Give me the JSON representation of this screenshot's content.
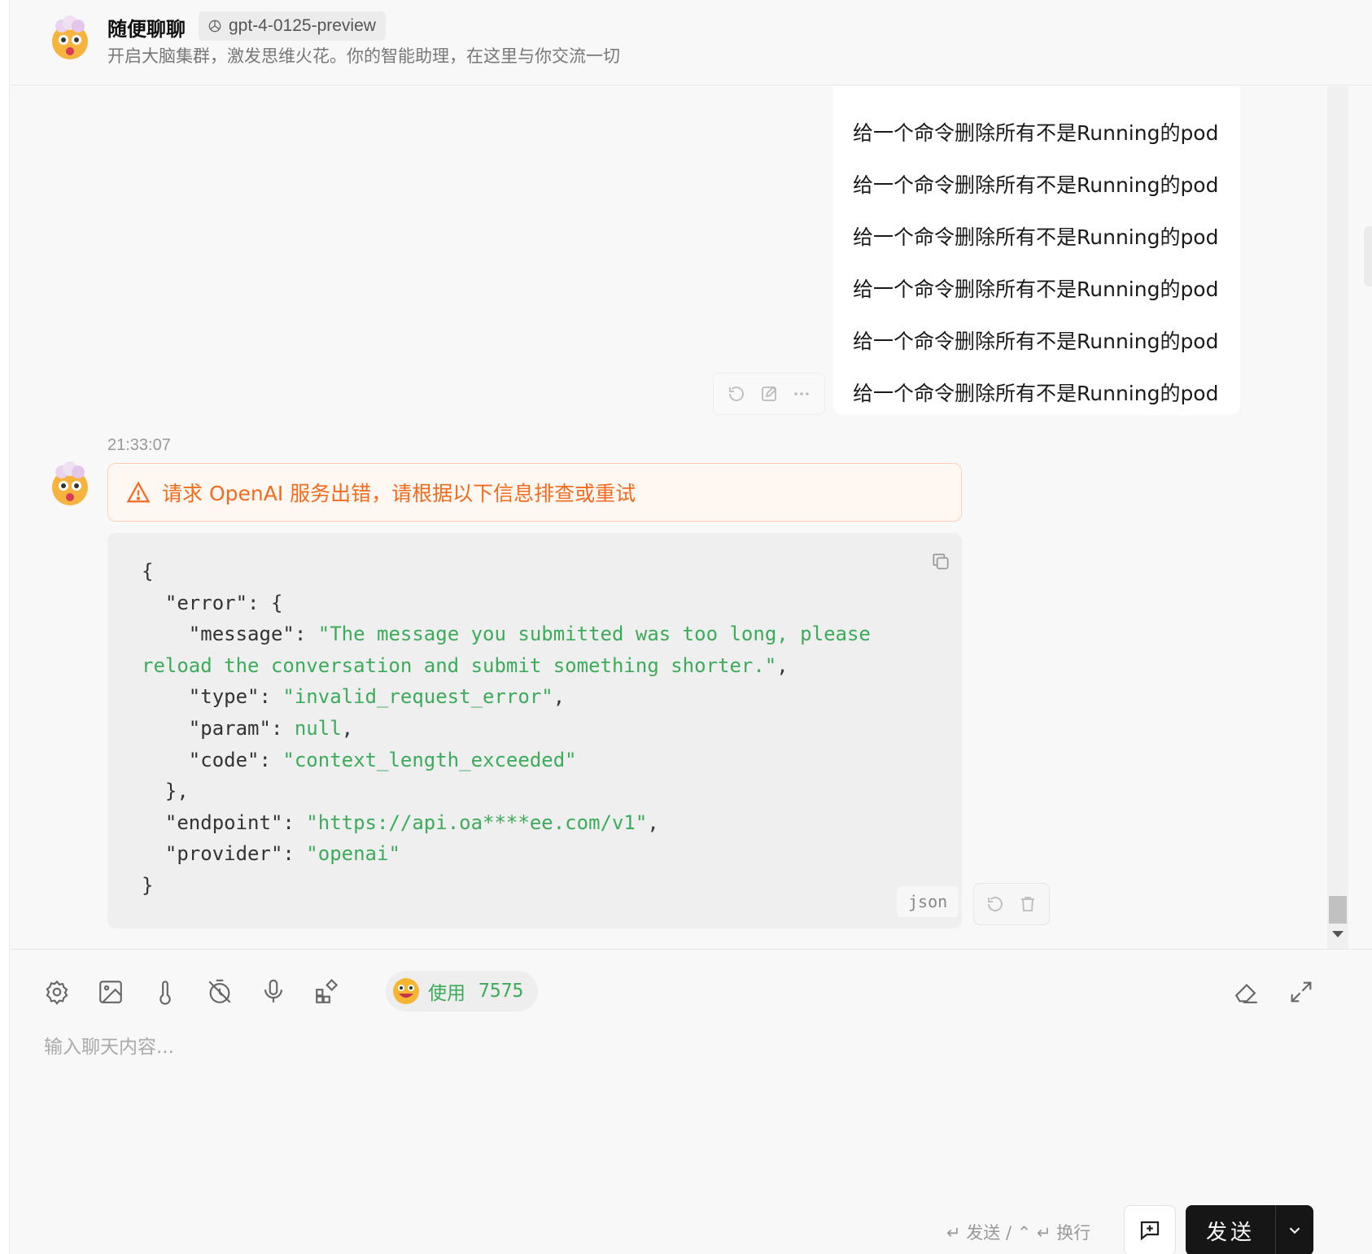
{
  "header": {
    "title": "随便聊聊",
    "model": "gpt-4-0125-preview",
    "subtitle": "开启大脑集群，激发思维火花。你的智能助理，在这里与你交流一切"
  },
  "user_message": {
    "lines": [
      "给一个命令删除所有不是Running的pod",
      "给一个命令删除所有不是Running的pod",
      "给一个命令删除所有不是Running的pod",
      "给一个命令删除所有不是Running的pod",
      "给一个命令删除所有不是Running的pod",
      "给一个命令删除所有不是Running的pod"
    ]
  },
  "assistant_message": {
    "timestamp": "21:33:07",
    "alert": "请求 OpenAI 服务出错，请根据以下信息排查或重试",
    "code_lang": "json",
    "code": {
      "l1": "{",
      "l2_key": "  \"error\": {",
      "l3_key": "    \"message\": ",
      "l3_val": "\"The message you submitted was too long, please",
      "l4_val": "reload the conversation and submit something shorter.\"",
      "l4_end": ",",
      "l5_key": "    \"type\": ",
      "l5_val": "\"invalid_request_error\"",
      "l5_end": ",",
      "l6_key": "    \"param\": ",
      "l6_val": "null",
      "l6_end": ",",
      "l7_key": "    \"code\": ",
      "l7_val": "\"context_length_exceeded\"",
      "l8": "  },",
      "l9_key": "  \"endpoint\": ",
      "l9_val": "\"https://api.oa****ee.com/v1\"",
      "l9_end": ",",
      "l10_key": "  \"provider\": ",
      "l10_val": "\"openai\"",
      "l11": "}"
    }
  },
  "input": {
    "usage_label": "使用",
    "usage_count": "7575",
    "placeholder": "输入聊天内容...",
    "hint": "↵ 发送 / ⌃ ↵ 换行",
    "send_label": "发送"
  },
  "colors": {
    "accent_green": "#3cab5a",
    "alert_orange": "#f26c1f",
    "send_button": "#161616"
  },
  "icons": [
    "openai-icon",
    "warning-icon",
    "copy-icon",
    "regenerate-icon",
    "edit-icon",
    "more-icon",
    "delete-icon",
    "settings-icon",
    "image-icon",
    "temperature-icon",
    "history-off-icon",
    "microphone-icon",
    "plugins-icon",
    "eraser-icon",
    "expand-icon",
    "new-topic-icon",
    "chevron-down-icon"
  ]
}
